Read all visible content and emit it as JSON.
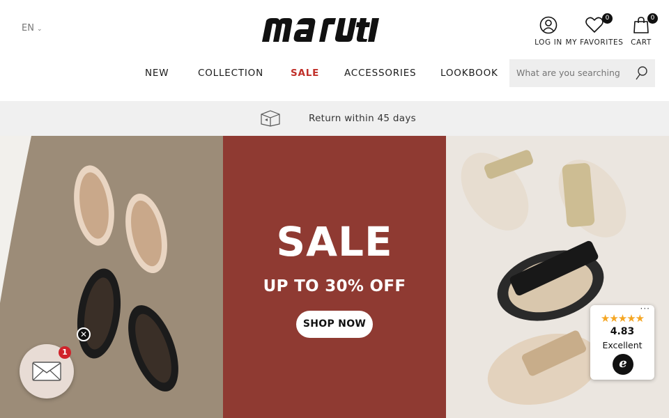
{
  "header": {
    "language": "EN",
    "logo_text": "maruti",
    "account": {
      "login_label": "LOG IN",
      "favorites_label": "MY FAVORITES",
      "favorites_count": "0",
      "cart_label": "CART",
      "cart_count": "0"
    }
  },
  "nav": {
    "items": [
      {
        "label": "NEW"
      },
      {
        "label": "COLLECTION"
      },
      {
        "label": "SALE"
      },
      {
        "label": "ACCESSORIES"
      },
      {
        "label": "LOOKBOOK"
      }
    ],
    "accent_sale_color": "#c0302a"
  },
  "search": {
    "placeholder": "What are you searching for?"
  },
  "returnbar": {
    "text": "Return within 45 days"
  },
  "hero": {
    "title": "SALE",
    "subtitle": "UP TO 30% OFF",
    "cta_label": "SHOP NOW",
    "mid_panel_color": "#8f3a32"
  },
  "chat": {
    "badge_count": "1"
  },
  "trust_widget": {
    "stars": "★★★★★",
    "score": "4.83",
    "label": "Excellent",
    "logo_letter": "e"
  },
  "icons": {
    "language": "chevron-down-icon",
    "login": "user-circle-icon",
    "favorites": "heart-icon",
    "cart": "shopping-bag-icon",
    "search": "search-icon",
    "returns": "box-return-icon",
    "chat": "envelope-icon",
    "close": "close-icon"
  }
}
